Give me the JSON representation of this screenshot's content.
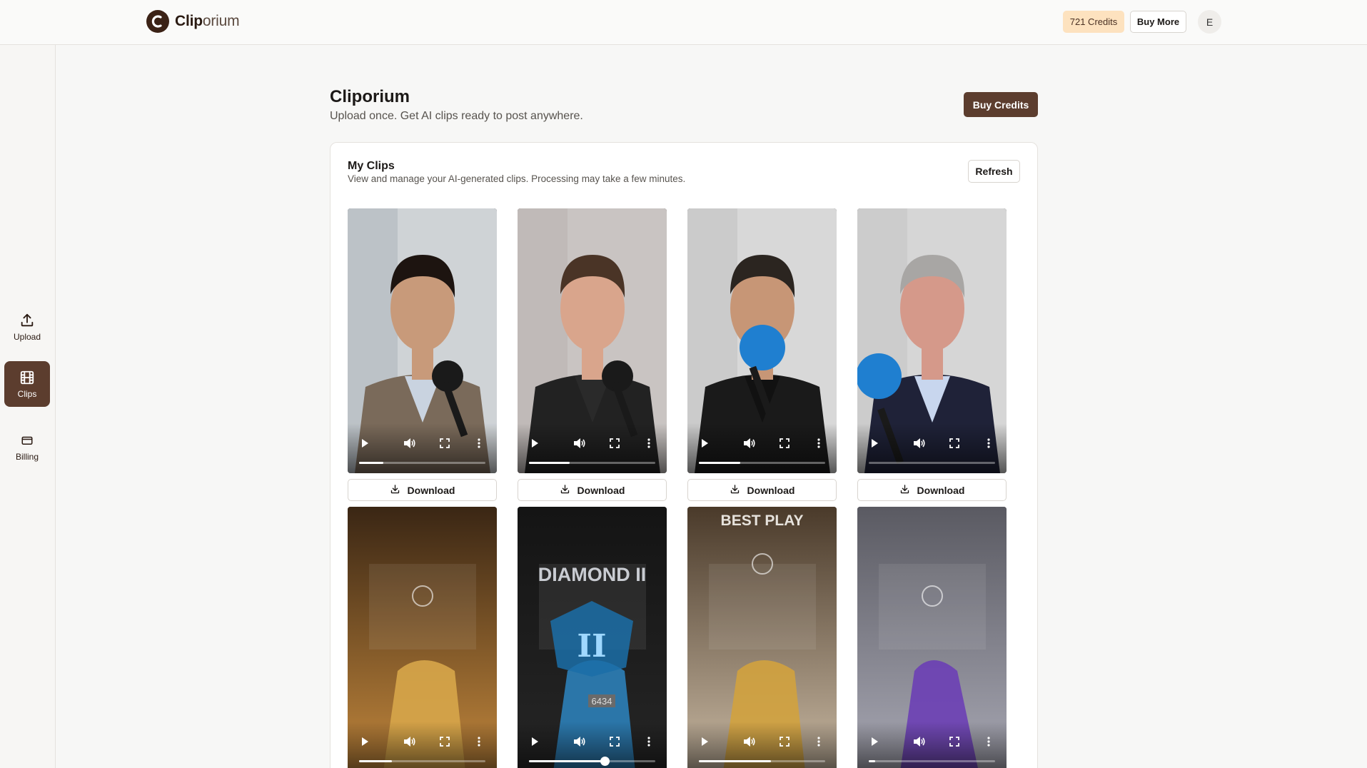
{
  "app": {
    "logo_name_bold": "Clip",
    "logo_name_light": "orium",
    "credits_badge": "721 Credits",
    "buy_more_label": "Buy More",
    "avatar_initial": "E"
  },
  "sidebar": {
    "items": [
      {
        "label": "Upload",
        "icon": "upload-icon",
        "active": false
      },
      {
        "label": "Clips",
        "icon": "film-icon",
        "active": true
      },
      {
        "label": "Billing",
        "icon": "credit-card-icon",
        "active": false
      }
    ]
  },
  "header": {
    "title": "Cliporium",
    "subtitle": "Upload once. Get AI clips ready to post anywhere.",
    "buy_credits_label": "Buy Credits"
  },
  "clips_card": {
    "title": "My Clips",
    "subtitle": "View and manage your AI-generated clips. Processing may take a few minutes.",
    "refresh_label": "Refresh",
    "download_label": "Download",
    "clips": [
      {
        "kind": "podcast",
        "progress": 0.19
      },
      {
        "kind": "podcast",
        "progress": 0.32
      },
      {
        "kind": "podcast",
        "progress": 0.33
      },
      {
        "kind": "podcast",
        "progress": 0.0
      },
      {
        "kind": "game",
        "progress": 0.26
      },
      {
        "kind": "game",
        "progress": 0.6,
        "overlay": "DIAMOND II",
        "score": "6434"
      },
      {
        "kind": "game",
        "progress": 0.57,
        "overlay": "BEST PLAY"
      },
      {
        "kind": "game",
        "progress": 0.05
      }
    ]
  },
  "colors": {
    "brand_brown": "#5c3d2e",
    "credits_badge_bg": "#fde2bf",
    "page_bg": "#f7f7f6"
  }
}
